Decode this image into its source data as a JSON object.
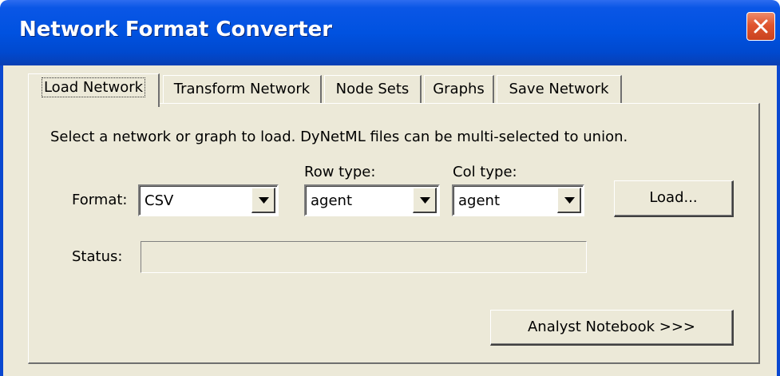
{
  "window": {
    "title": "Network Format Converter",
    "title_bar_color": "#0052e0",
    "close_icon": "close-icon"
  },
  "tabs": [
    {
      "label": "Load Network",
      "active": true
    },
    {
      "label": "Transform Network",
      "active": false
    },
    {
      "label": "Node Sets",
      "active": false
    },
    {
      "label": "Graphs",
      "active": false
    },
    {
      "label": "Save Network",
      "active": false
    }
  ],
  "load_panel": {
    "instructions": "Select a network or graph to load.  DyNetML files can be multi-selected to union.",
    "format_label": "Format:",
    "format_value": "CSV",
    "row_type_label": "Row type:",
    "row_type_value": "agent",
    "col_type_label": "Col type:",
    "col_type_value": "agent",
    "load_button": "Load...",
    "status_label": "Status:",
    "status_value": "",
    "analyst_button": "Analyst Notebook >>>"
  }
}
